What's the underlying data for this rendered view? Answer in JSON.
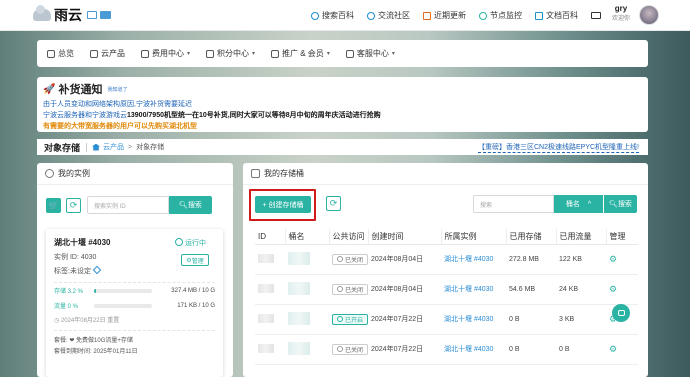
{
  "brand": {
    "name": "雨云"
  },
  "topnav": [
    {
      "label": "搜索百科",
      "icon": "search-icon"
    },
    {
      "label": "交流社区",
      "icon": "community-icon"
    },
    {
      "label": "近期更新",
      "icon": "update-icon"
    },
    {
      "label": "节点监控",
      "icon": "monitor-icon"
    },
    {
      "label": "文档百科",
      "icon": "docs-icon"
    }
  ],
  "user": {
    "name": "gry",
    "welcome": "欢迎你"
  },
  "menu": [
    {
      "label": "总览",
      "icon": "overview-icon",
      "has_dropdown": false
    },
    {
      "label": "云产品",
      "icon": "cloud-icon",
      "has_dropdown": false
    },
    {
      "label": "费用中心",
      "icon": "billing-icon",
      "has_dropdown": true
    },
    {
      "label": "积分中心",
      "icon": "points-icon",
      "has_dropdown": true
    },
    {
      "label": "推广 & 会员",
      "icon": "promo-icon",
      "has_dropdown": true
    },
    {
      "label": "客服中心",
      "icon": "support-icon",
      "has_dropdown": true
    }
  ],
  "notice": {
    "title": "补货通知",
    "tag": "我知道了",
    "line1": "由于人员变动和网络架构原因,宁波补货需要延迟",
    "line2a": "宁波云服务器和宁波游戏云",
    "line2b": "13900/7950机型统一在10号补货,同时大家可以等待8月中旬的周年庆活动进行抢购",
    "line3": "有需要的大带宽服务器的用户可以先购买湖北机型"
  },
  "breadcrumb": {
    "title": "对象存储",
    "parent": "云产品",
    "sep": ">",
    "current": "对象存储"
  },
  "promo_link": "【重磅】香港三区CN2极速线路EPYC机型隆重上线!",
  "left_panel": {
    "title": "我的实例",
    "search_placeholder": "搜索实例 ID",
    "search_button": "搜索",
    "instance": {
      "title": "湖北十堰 #4030",
      "status": "运行中",
      "id_label": "实例 ID: 4030",
      "tag_label": "标签:",
      "tag_value": "未设定",
      "manage": "管理",
      "storage_label": "存储 3.2 %",
      "storage_percent": 3.2,
      "storage_value": "327.4 MB / 10 G",
      "traffic_label": "流量 0 %",
      "traffic_percent": 0,
      "traffic_value": "171 KB / 10 G",
      "reset_date": "2024年08月22日 重置",
      "package": "套餐: ❤ 免费做10G流量+存储",
      "expire": "套餐到期时间: 2025年01月11日"
    }
  },
  "right_panel": {
    "title": "我的存储桶",
    "create_button": "+ 创建存储桶",
    "search_placeholder": "搜索",
    "dropdown": "桶名",
    "search_button": "搜索",
    "columns": [
      "ID",
      "桶名",
      "公共访问",
      "创建时间",
      "所属实例",
      "已用存储",
      "已用流量",
      "管理"
    ],
    "rows": [
      {
        "access": "已关闭",
        "on": false,
        "created": "2024年08月04日",
        "instance": "湖北十堰 #4030",
        "storage": "272.8 MB",
        "traffic": "122 KB"
      },
      {
        "access": "已关闭",
        "on": false,
        "created": "2024年08月04日",
        "instance": "湖北十堰 #4030",
        "storage": "54.6 MB",
        "traffic": "24 KB"
      },
      {
        "access": "已开启",
        "on": true,
        "created": "2024年07月22日",
        "instance": "湖北十堰 #4030",
        "storage": "0 B",
        "traffic": "3 KB"
      },
      {
        "access": "已关闭",
        "on": false,
        "created": "2024年07月22日",
        "instance": "湖北十堰 #4030",
        "storage": "0 B",
        "traffic": "0 B"
      }
    ]
  }
}
